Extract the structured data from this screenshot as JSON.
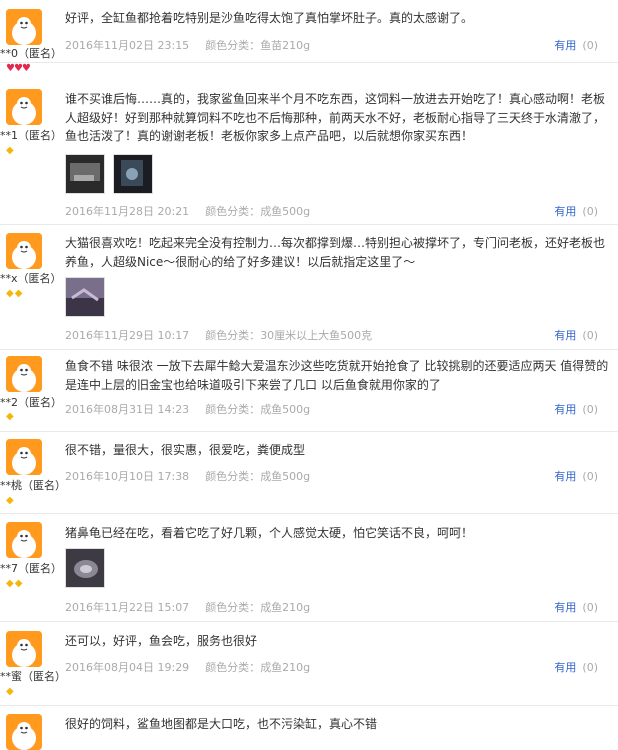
{
  "useful_label": "有用",
  "variant_prefix": "颜色分类：",
  "reviews": [
    {
      "user": "**0（匿名）",
      "text": "好评，全缸鱼都抢着吃特别是沙鱼吃得太饱了真怕掌坏肚子。真的太感谢了。",
      "date": "2016年11月02日 23:15",
      "variant": "鱼苗210g",
      "useful_count": "(0)",
      "rank": "hearts"
    },
    {
      "user": "**1（匿名）",
      "text": "谁不买谁后悔……真的，我家鲨鱼回来半个月不吃东西，这饲料一放进去开始吃了！真心感动啊！老板人超级好！好到那种就算饲料不吃也不后悔那种，前两天水不好，老板耐心指导了三天终于水清澈了，鱼也活泼了！真的谢谢老板！老板你家多上点产品吧，以后就想你家买东西！",
      "date": "2016年11月28日 20:21",
      "variant": "成鱼500g",
      "useful_count": "(0)",
      "rank": "diamond1"
    },
    {
      "user": "**x（匿名）",
      "text": "大猫很喜欢吃！吃起来完全没有控制力…每次都撑到爆…特别担心被撑坏了，专门问老板，还好老板也养鱼，人超级Nice～很耐心的给了好多建议！以后就指定这里了～",
      "date": "2016年11月29日 10:17",
      "variant": "30厘米以上大鱼500克",
      "useful_count": "(0)",
      "rank": "diamond2"
    },
    {
      "user": "**2（匿名）",
      "text": "鱼食不错 味很浓 一放下去犀牛鲶大爱温东沙这些吃货就开始抢食了 比较挑剔的还要适应两天 值得赞的是连中上层的旧金宝也给味道吸引下来尝了几口 以后鱼食就用你家的了",
      "date": "2016年08月31日 14:23",
      "variant": "成鱼500g",
      "useful_count": "(0)",
      "rank": "diamond1"
    },
    {
      "user": "**桃（匿名）",
      "text": "很不错，量很大，很实惠，很爱吃，粪便成型",
      "date": "2016年10月10日 17:38",
      "variant": "成鱼500g",
      "useful_count": "(0)",
      "rank": "diamond1"
    },
    {
      "user": "**7（匿名）",
      "text": "猪鼻龟已经在吃，看着它吃了好几颗，个人感觉太硬，怕它笑话不良，呵呵！",
      "date": "2016年11月22日 15:07",
      "variant": "成鱼210g",
      "useful_count": "(0)",
      "rank": "diamond2"
    },
    {
      "user": "**蜜（匿名）",
      "text": "还可以，好评，鱼会吃，服务也很好",
      "date": "2016年08月04日 19:29",
      "variant": "成鱼210g",
      "useful_count": "(0)",
      "rank": "diamond1"
    },
    {
      "user": "",
      "text": "很好的饲料，鲨鱼地图都是大口吃，也不污染缸，真心不错",
      "date": "",
      "variant": "",
      "useful_count": "",
      "rank": ""
    }
  ]
}
